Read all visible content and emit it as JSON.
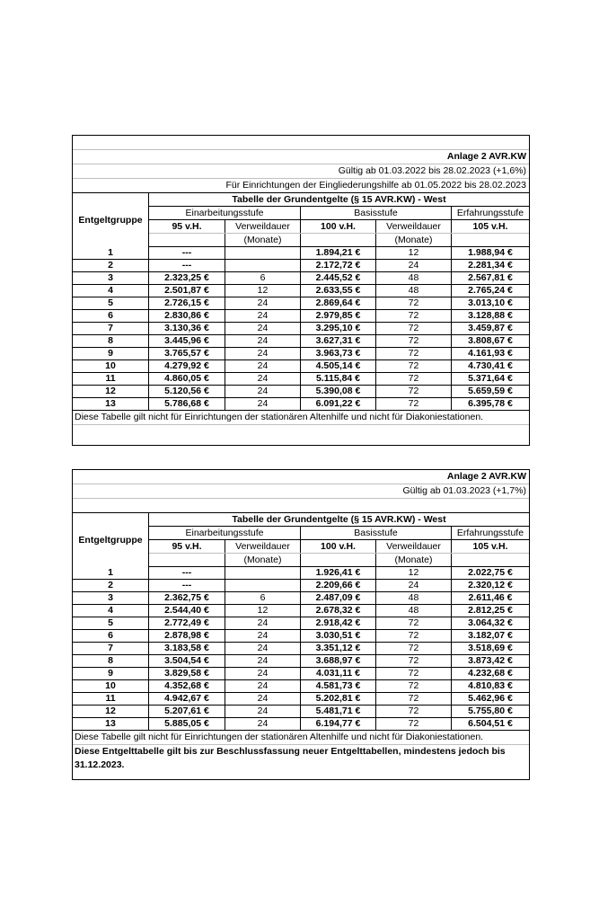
{
  "table1": {
    "annex": "Anlage 2 AVR.KW",
    "validity": "Gültig ab 01.03.2022 bis 28.02.2023 (+1,6%)",
    "validity2": "Für Einrichtungen der Eingliederungshilfe ab 01.05.2022 bis 28.02.2023",
    "title": "Tabelle der Grundentgelte (§ 15 AVR.KW) - West",
    "col_group": "Entgeltgruppe",
    "stage1": "Einarbeitungsstufe",
    "stage2": "Basisstufe",
    "stage3": "Erfahrungsstufe",
    "p95": "95 v.H.",
    "stay1": "Verweildauer",
    "p100": "100 v.H.",
    "stay2": "Verweildauer",
    "p105": "105 v.H.",
    "months1": "(Monate)",
    "months2": "(Monate)",
    "rows": [
      [
        "1",
        "---",
        "",
        "1.894,21 €",
        "12",
        "1.988,94 €"
      ],
      [
        "2",
        "---",
        "",
        "2.172,72 €",
        "24",
        "2.281,34 €"
      ],
      [
        "3",
        "2.323,25 €",
        "6",
        "2.445,52 €",
        "48",
        "2.567,81 €"
      ],
      [
        "4",
        "2.501,87 €",
        "12",
        "2.633,55 €",
        "48",
        "2.765,24 €"
      ],
      [
        "5",
        "2.726,15 €",
        "24",
        "2.869,64 €",
        "72",
        "3.013,10 €"
      ],
      [
        "6",
        "2.830,86 €",
        "24",
        "2.979,85 €",
        "72",
        "3.128,88 €"
      ],
      [
        "7",
        "3.130,36 €",
        "24",
        "3.295,10 €",
        "72",
        "3.459,87 €"
      ],
      [
        "8",
        "3.445,96 €",
        "24",
        "3.627,31 €",
        "72",
        "3.808,67 €"
      ],
      [
        "9",
        "3.765,57 €",
        "24",
        "3.963,73 €",
        "72",
        "4.161,93 €"
      ],
      [
        "10",
        "4.279,92 €",
        "24",
        "4.505,14 €",
        "72",
        "4.730,41 €"
      ],
      [
        "11",
        "4.860,05 €",
        "24",
        "5.115,84 €",
        "72",
        "5.371,64 €"
      ],
      [
        "12",
        "5.120,56 €",
        "24",
        "5.390,08 €",
        "72",
        "5.659,59 €"
      ],
      [
        "13",
        "5.786,68 €",
        "24",
        "6.091,22 €",
        "72",
        "6.395,78 €"
      ]
    ],
    "note": "Diese Tabelle gilt nicht für Einrichtungen der stationären Altenhilfe und nicht für Diakoniestationen."
  },
  "table2": {
    "annex": "Anlage 2 AVR.KW",
    "validity": "Gültig ab 01.03.2023 (+1,7%)",
    "title": "Tabelle der Grundentgelte (§ 15 AVR.KW) - West",
    "col_group": "Entgeltgruppe",
    "stage1": "Einarbeitungsstufe",
    "stage2": "Basisstufe",
    "stage3": "Erfahrungsstufe",
    "p95": "95 v.H.",
    "stay1": "Verweildauer",
    "p100": "100 v.H.",
    "stay2": "Verweildauer",
    "p105": "105 v.H.",
    "months1": "(Monate)",
    "months2": "(Monate)",
    "rows": [
      [
        "1",
        "---",
        "",
        "1.926,41 €",
        "12",
        "2.022,75 €"
      ],
      [
        "2",
        "---",
        "",
        "2.209,66 €",
        "24",
        "2.320,12 €"
      ],
      [
        "3",
        "2.362,75 €",
        "6",
        "2.487,09 €",
        "48",
        "2.611,46 €"
      ],
      [
        "4",
        "2.544,40 €",
        "12",
        "2.678,32 €",
        "48",
        "2.812,25 €"
      ],
      [
        "5",
        "2.772,49 €",
        "24",
        "2.918,42 €",
        "72",
        "3.064,32 €"
      ],
      [
        "6",
        "2.878,98 €",
        "24",
        "3.030,51 €",
        "72",
        "3.182,07 €"
      ],
      [
        "7",
        "3.183,58 €",
        "24",
        "3.351,12 €",
        "72",
        "3.518,69 €"
      ],
      [
        "8",
        "3.504,54 €",
        "24",
        "3.688,97 €",
        "72",
        "3.873,42 €"
      ],
      [
        "9",
        "3.829,58 €",
        "24",
        "4.031,11 €",
        "72",
        "4.232,68 €"
      ],
      [
        "10",
        "4.352,68 €",
        "24",
        "4.581,73 €",
        "72",
        "4.810,83 €"
      ],
      [
        "11",
        "4.942,67 €",
        "24",
        "5.202,81 €",
        "72",
        "5.462,96 €"
      ],
      [
        "12",
        "5.207,61 €",
        "24",
        "5.481,71 €",
        "72",
        "5.755,80 €"
      ],
      [
        "13",
        "5.885,05 €",
        "24",
        "6.194,77 €",
        "72",
        "6.504,51 €"
      ]
    ],
    "note": "Diese Tabelle gilt nicht für Einrichtungen der stationären Altenhilfe und nicht für Diakoniestationen.",
    "note2": "Diese Entgelttabelle gilt bis zur Beschlussfassung neuer Entgelttabellen, mindestens jedoch bis 31.12.2023."
  }
}
